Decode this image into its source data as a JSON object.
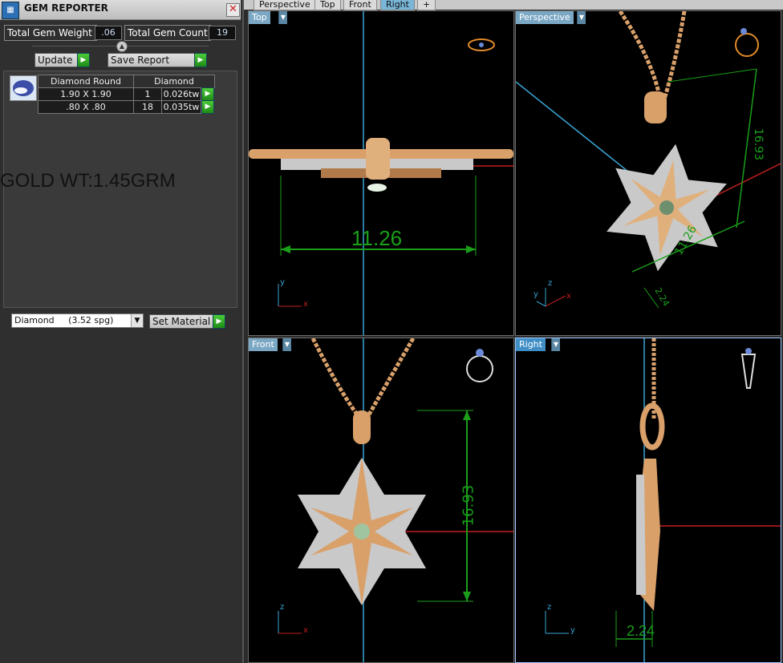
{
  "panel": {
    "title": "GEM REPORTER",
    "close_glyph": "✕",
    "total_gem_weight_label": "Total Gem Weight",
    "total_gem_weight_value": ".06",
    "total_gem_count_label": "Total Gem Count",
    "total_gem_count_value": "19",
    "update_label": "Update",
    "save_report_label": "Save Report",
    "gem_table": {
      "headers": [
        "Diamond Round",
        "Diamond"
      ],
      "rows": [
        {
          "size": "1.90 X 1.90",
          "count": "1",
          "weight": "0.026tw"
        },
        {
          "size": ".80 X .80",
          "count": "18",
          "weight": "0.035tw"
        }
      ]
    },
    "gold_weight_note": "GOLD WT:1.45GRM",
    "material_selected": "Diamond     (3.52 spg)",
    "set_material_label": "Set Material"
  },
  "viewport_tabs": [
    "Perspective",
    "Top",
    "Front",
    "Right",
    "+"
  ],
  "active_tab": "Right",
  "viewports": [
    {
      "name": "Top",
      "dimension": "11.26",
      "axis_a": "y",
      "axis_b": "x"
    },
    {
      "name": "Perspective",
      "dimension_a": "16.93",
      "dimension_b": "11.26",
      "dimension_c": "2.24",
      "axis_a": "z",
      "axis_b": "y",
      "axis_c": "x"
    },
    {
      "name": "Front",
      "dimension": "16.93",
      "axis_a": "z",
      "axis_b": "x"
    },
    {
      "name": "Right",
      "dimension": "2.24",
      "axis_a": "z",
      "axis_b": "y"
    }
  ],
  "colors": {
    "gold": "#d9a06a",
    "silver": "#c9c9c9",
    "dimension_green": "#1a9e1a",
    "axis_red": "#c21f1f",
    "axis_cyan": "#3aa6d6",
    "viewport_label": "#7aa7c4"
  }
}
